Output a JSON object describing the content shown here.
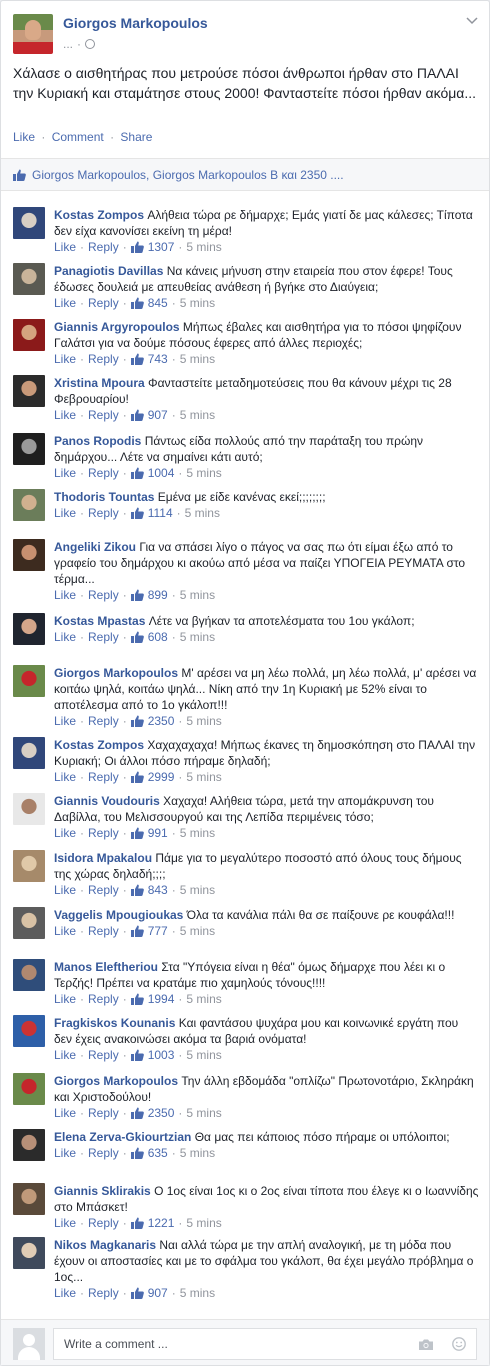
{
  "post": {
    "author": "Giorgos Markopoulos",
    "meta": "...",
    "text": "Χάλασε ο αισθητήρας που μετρούσε πόσοι άνθρωποι ήρθαν στο ΠΑΛΑΙ την Κυριακή και σταμάτησε στους 2000! Φανταστείτε πόσοι ήρθαν ακόμα...",
    "actions": {
      "like": "Like",
      "comment": "Comment",
      "share": "Share",
      "separator": "·"
    },
    "likes_summary": "Giorgos Markopoulos, Giorgos Markopoulos B και 2350 ...."
  },
  "comment_labels": {
    "like": "Like",
    "reply": "Reply",
    "separator": "·"
  },
  "comments": [
    {
      "name": "Kostas Zompos",
      "text": "Αλήθεια τώρα ρε δήμαρχε; Εμάς γιατί δε μας κάλεσες; Τίποτα δεν είχα κανονίσει εκείνη τη μέρα!",
      "likes": "1307",
      "time": "5 mins"
    },
    {
      "name": "Panagiotis Davillas",
      "text": "Να κάνεις μήνυση στην εταιρεία που στον έφερε! Τους έδωσες δουλειά με απευθείας ανάθεση ή βγήκε στο Διαύγεια;",
      "likes": "845",
      "time": "5 mins"
    },
    {
      "name": "Giannis Argyropoulos",
      "text": "Μήπως έβαλες και αισθητήρα για το πόσοι ψηφίζουν Γαλάτσι για να δούμε πόσους έφερες από άλλες περιοχές;",
      "likes": "743",
      "time": "5 mins"
    },
    {
      "name": "Xristina Mpoura",
      "text": "Φανταστείτε μεταδημοτεύσεις που θα κάνουν μέχρι τις 28 Φεβρουαρίου!",
      "likes": "907",
      "time": "5 mins"
    },
    {
      "name": "Panos Ropodis",
      "text": "Πάντως είδα πολλούς από την παράταξη του πρώην δημάρχου... Λέτε να σημαίνει κάτι αυτό;",
      "likes": "1004",
      "time": "5 mins"
    },
    {
      "name": "Thodoris Tountas",
      "text": "Εμένα με είδε κανένας εκεί;;;;;;;;",
      "likes": "1114",
      "time": "5 mins"
    },
    {
      "name": "Angeliki Zikou",
      "text": "Για να σπάσει λίγο ο πάγος να σας πω ότι είμαι έξω από το γραφείο του δημάρχου κι ακούω από μέσα να παίζει ΥΠΟΓΕΙΑ ΡΕΥΜΑΤΑ στο τέρμα...",
      "likes": "899",
      "time": "5 mins"
    },
    {
      "name": "Kostas Mpastas",
      "text": "Λέτε να βγήκαν τα αποτελέσματα του 1ου γκάλοπ;",
      "likes": "608",
      "time": "5 mins"
    },
    {
      "name": "Giorgos Markopoulos",
      "text": "Μ' αρέσει να μη λέω πολλά, μη λέω πολλά, μ' αρέσει να κοιτάω ψηλά, κοιτάω ψηλά... Νίκη από την 1η Κυριακή με 52% είναι το αποτέλεσμα από το 1ο γκάλοπ!!!",
      "likes": "2350",
      "time": "5 mins"
    },
    {
      "name": "Kostas Zompos",
      "text": "Χαχαχαχαχα! Μήπως έκανες τη δημοσκόπηση στο ΠΑΛΑΙ την Κυριακή; Οι άλλοι πόσο πήραμε δηλαδή;",
      "likes": "2999",
      "time": "5 mins"
    },
    {
      "name": "Giannis Voudouris",
      "text": "Χαχαχα! Αλήθεια τώρα, μετά την απομάκρυνση του Δαβίλλα, του Μελισσουργού και της Λεπίδα περιμένεις τόσο;",
      "likes": "991",
      "time": "5 mins"
    },
    {
      "name": "Isidora Mpakalou",
      "text": "Πάμε για το μεγαλύτερο ποσοστό από όλους τους δήμους της χώρας δηλαδή;;;;",
      "likes": "843",
      "time": "5 mins"
    },
    {
      "name": "Vaggelis Mpougioukas",
      "text": "Όλα τα κανάλια πάλι θα σε παίξουνε ρε κουφάλα!!!",
      "likes": "777",
      "time": "5 mins"
    },
    {
      "name": "Manos Eleftheriou",
      "text": "Στα \"Υπόγεια είναι η θέα\" όμως δήμαρχε που λέει κι ο Τερζής! Πρέπει να κρατάμε πιο χαμηλούς τόνους!!!!",
      "likes": "1994",
      "time": "5 mins"
    },
    {
      "name": "Fragkiskos Kounanis",
      "text": "Και φαντάσου ψυχάρα μου και κοινωνικέ εργάτη που δεν έχεις ανακοινώσει ακόμα τα βαριά ονόματα!",
      "likes": "1003",
      "time": "5 mins"
    },
    {
      "name": "Giorgos Markopoulos",
      "text": "Την άλλη εβδομάδα \"οπλίζω\" Πρωτονοτάριο, Σκληράκη και Χριστοδούλου!",
      "likes": "2350",
      "time": "5 mins"
    },
    {
      "name": "Elena Zerva-Gkiourtzian",
      "text": "Θα μας πει κάποιος πόσο πήραμε οι υπόλοιποι;",
      "likes": "635",
      "time": "5 mins"
    },
    {
      "name": "Giannis Sklirakis",
      "text": "Ο 1ος είναι 1ος κι ο 2ος είναι τίποτα που έλεγε κι ο Ιωαννίδης στο Μπάσκετ!",
      "likes": "1221",
      "time": "5 mins"
    },
    {
      "name": "Nikos Magkanaris",
      "text": "Ναι αλλά τώρα με την απλή αναλογική, με τη μόδα που έχουν οι αποστασίες και με το σφάλμα του γκάλοπ, θα έχει μεγάλο πρόβλημα ο 1ος...",
      "likes": "907",
      "time": "5 mins"
    }
  ],
  "composer": {
    "placeholder": "Write a comment ..."
  },
  "colors": {
    "link": "#365899",
    "action": "#4b6baf",
    "muted": "#90949c"
  }
}
